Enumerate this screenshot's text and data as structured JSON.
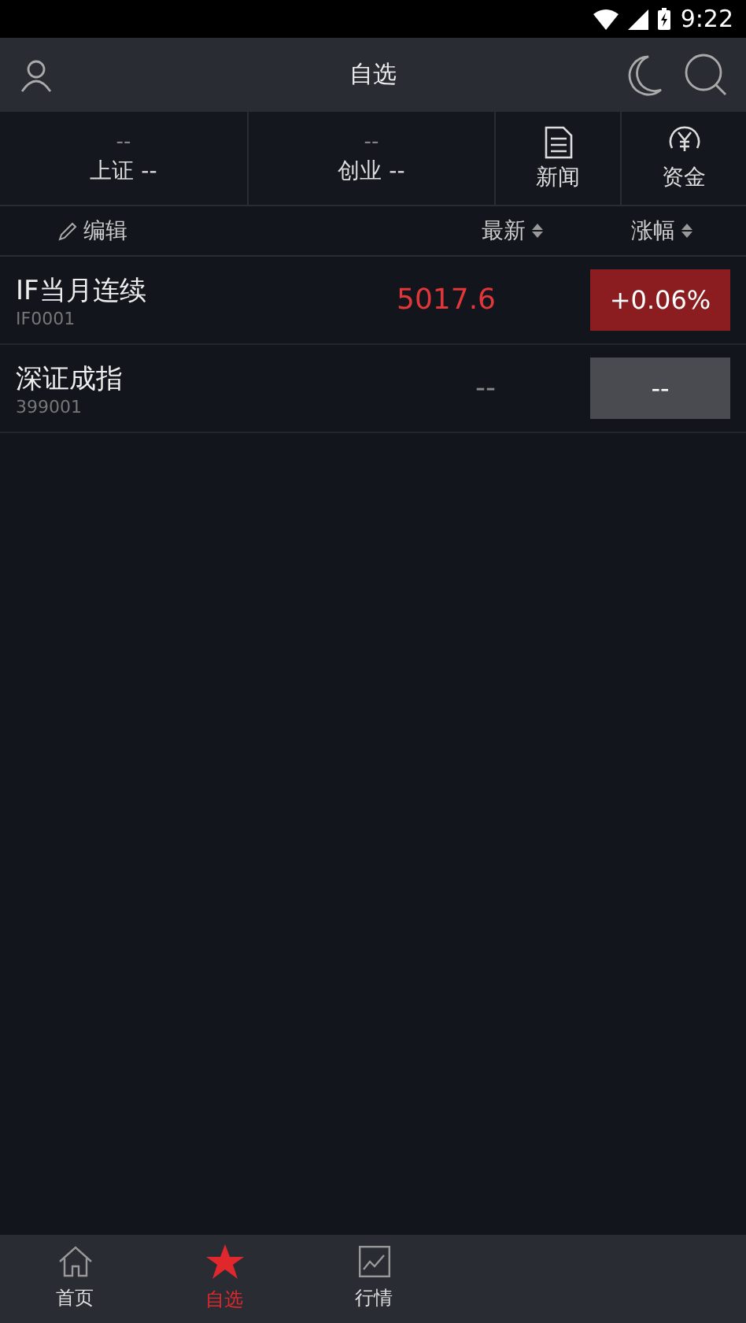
{
  "status_bar": {
    "time": "9:22"
  },
  "header": {
    "title": "自选"
  },
  "indices": [
    {
      "value": "--",
      "label": "上证 --"
    },
    {
      "value": "--",
      "label": "创业 --"
    }
  ],
  "shortcuts": [
    {
      "kind": "news",
      "label": "新闻"
    },
    {
      "kind": "funds",
      "label": "资金"
    }
  ],
  "columns": {
    "edit": "编辑",
    "latest": "最新",
    "change": "涨幅"
  },
  "rows": [
    {
      "name": "IF当月连续",
      "code": "IF0001",
      "price": "5017.6",
      "change": "+0.06%",
      "kind": "up"
    },
    {
      "name": "深证成指",
      "code": "399001",
      "price": "--",
      "change": "--",
      "kind": "flat"
    }
  ],
  "tabs": [
    {
      "kind": "home",
      "label": "首页",
      "selected": false
    },
    {
      "kind": "star",
      "label": "自选",
      "selected": true
    },
    {
      "kind": "chart",
      "label": "行情",
      "selected": false
    }
  ]
}
